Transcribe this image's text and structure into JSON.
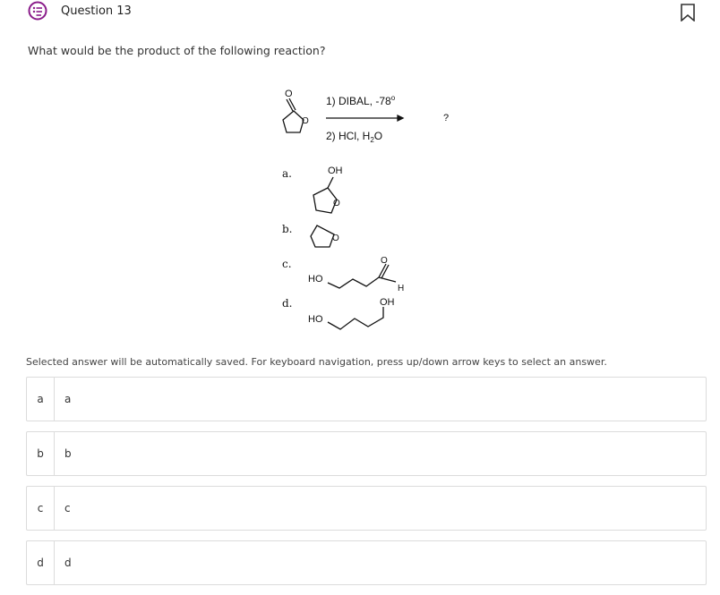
{
  "header": {
    "title": "Question 13",
    "icon": "multiple-choice-icon",
    "accent_color": "#8a1c8a",
    "flag_icon": "flag-bookmark-icon"
  },
  "question": {
    "prompt": "What would be the product of the following reaction?"
  },
  "reaction": {
    "step1": "1) DIBAL, -78",
    "step1_degree": "o",
    "step2_prefix": "2) HCl, H",
    "step2_sub": "2",
    "step2_suffix": "O",
    "product": "?",
    "ring_atom": "O"
  },
  "choices_figure": {
    "labels": [
      "a.",
      "b.",
      "c.",
      "d."
    ],
    "a_group": "OH",
    "c_left": "HO",
    "c_right": "H",
    "d_left": "HO",
    "d_top": "OH"
  },
  "hint": "Selected answer will be automatically saved. For keyboard navigation, press up/down arrow keys to select an answer.",
  "answers": [
    {
      "letter": "a",
      "text": "a"
    },
    {
      "letter": "b",
      "text": "b"
    },
    {
      "letter": "c",
      "text": "c"
    },
    {
      "letter": "d",
      "text": "d"
    }
  ]
}
